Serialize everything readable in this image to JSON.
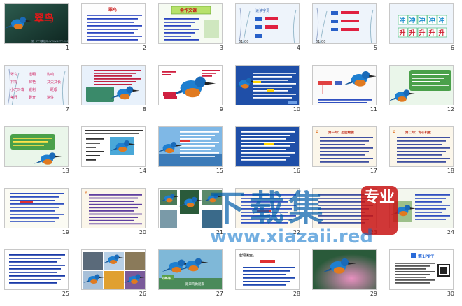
{
  "slides": [
    {
      "n": "1",
      "theme": "dark-title",
      "title": "翠鸟",
      "footer": "第一PPT模板网-WWW.1PPT.COM"
    },
    {
      "n": "2",
      "theme": "text",
      "title": "翠鸟"
    },
    {
      "n": "3",
      "theme": "banner",
      "title": "会作文课"
    },
    {
      "n": "4",
      "theme": "vocab",
      "title": "读读字词",
      "time": "01:00"
    },
    {
      "n": "5",
      "theme": "vocab2",
      "time": "01:00"
    },
    {
      "n": "6",
      "theme": "grid-chars",
      "row1": [
        "冲",
        "冲",
        "冲",
        "冲",
        "冲"
      ],
      "row2": [
        "升",
        "升",
        "升",
        "升",
        "升"
      ]
    },
    {
      "n": "7",
      "theme": "words",
      "words": [
        "翠鸟",
        "透明",
        "影响",
        "衬得",
        "鲜艳",
        "又尖又长",
        "小巧玲珑",
        "锐利",
        "一眨眼",
        "苇秆",
        "蹬开",
        "逮住"
      ]
    },
    {
      "n": "8",
      "theme": "bird-text"
    },
    {
      "n": "9",
      "theme": "bird-labels"
    },
    {
      "n": "10",
      "theme": "blue-text"
    },
    {
      "n": "11",
      "theme": "bird-diagram"
    },
    {
      "n": "12",
      "theme": "green-card"
    },
    {
      "n": "13",
      "theme": "green-card2"
    },
    {
      "n": "14",
      "theme": "bird-list"
    },
    {
      "n": "15",
      "theme": "sky-text"
    },
    {
      "n": "16",
      "theme": "sky-text2"
    },
    {
      "n": "17",
      "theme": "text-block",
      "title": "第一句：迅猛敏捷"
    },
    {
      "n": "18",
      "theme": "text-block",
      "title": "第二句：专心机敏"
    },
    {
      "n": "19",
      "theme": "text-block2"
    },
    {
      "n": "20",
      "theme": "text-block3"
    },
    {
      "n": "21",
      "theme": "photos"
    },
    {
      "n": "22",
      "theme": "text-block4"
    },
    {
      "n": "23",
      "theme": "text-block5"
    },
    {
      "n": "24",
      "theme": "bird-photo"
    },
    {
      "n": "25",
      "theme": "plain-text"
    },
    {
      "n": "26",
      "theme": "photo-collage"
    },
    {
      "n": "27",
      "theme": "birds-pair",
      "label": "小练笔",
      "footer": "跟翠鸟做朋友"
    },
    {
      "n": "28",
      "theme": "fill-in",
      "title": "选词填空。"
    },
    {
      "n": "29",
      "theme": "lotus-bird"
    },
    {
      "n": "30",
      "theme": "ad",
      "brand": "第1PPT"
    }
  ],
  "watermark": {
    "main": "下载集",
    "seal": "专业",
    "url": "www.xiazaii.red"
  },
  "colors": {
    "slide_border": "#c8c8c8",
    "number": "#333333",
    "watermark_blue": "#005caa",
    "watermark_red": "#c81414"
  }
}
